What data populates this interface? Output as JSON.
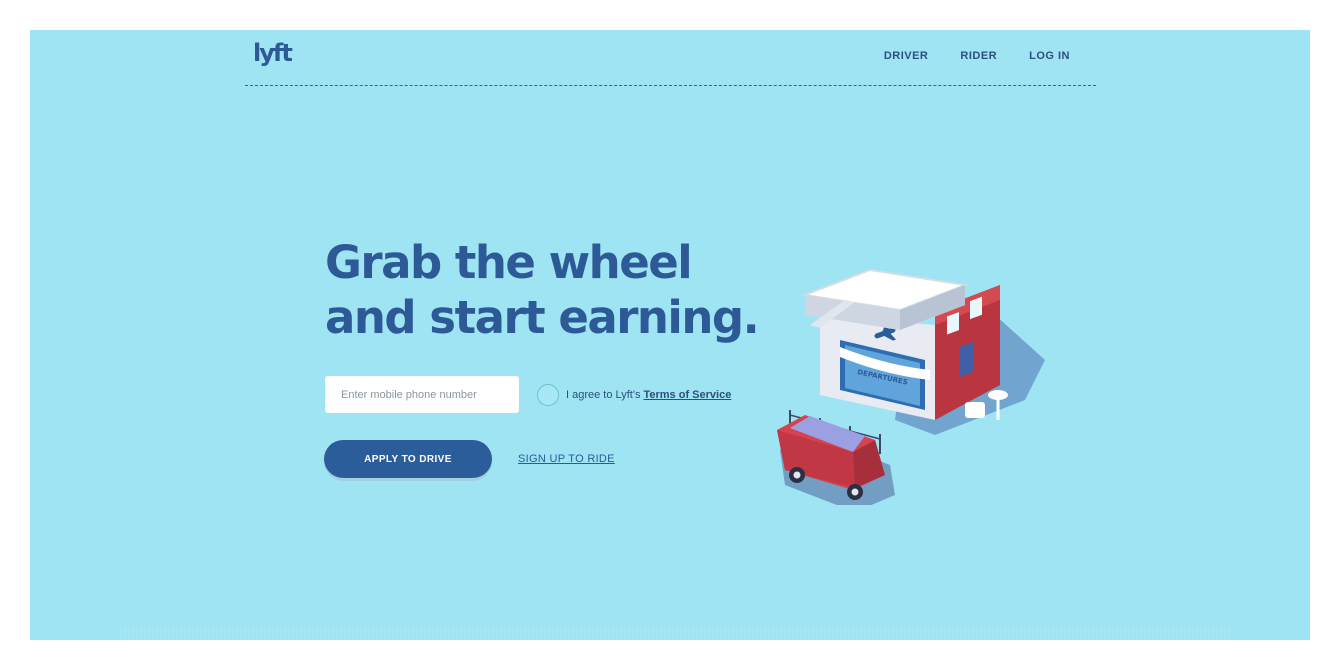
{
  "header": {
    "logo_text": "lyft",
    "nav": [
      "DRIVER",
      "RIDER",
      "LOG IN"
    ]
  },
  "hero": {
    "headline_line1": "Grab the wheel",
    "headline_line2": "and start earning.",
    "phone_placeholder": "Enter mobile phone number",
    "agree_prefix": "I agree to Lyft's",
    "terms_link": "Terms of Service",
    "apply_button": "APPLY TO DRIVE",
    "ride_link": "SIGN UP TO RIDE"
  },
  "illustration": {
    "sign_text": "DEPARTURES"
  },
  "colors": {
    "background": "#9ee4f2",
    "brand": "#2b5d9a",
    "car": "#d6434e",
    "building": "#b9353f"
  }
}
